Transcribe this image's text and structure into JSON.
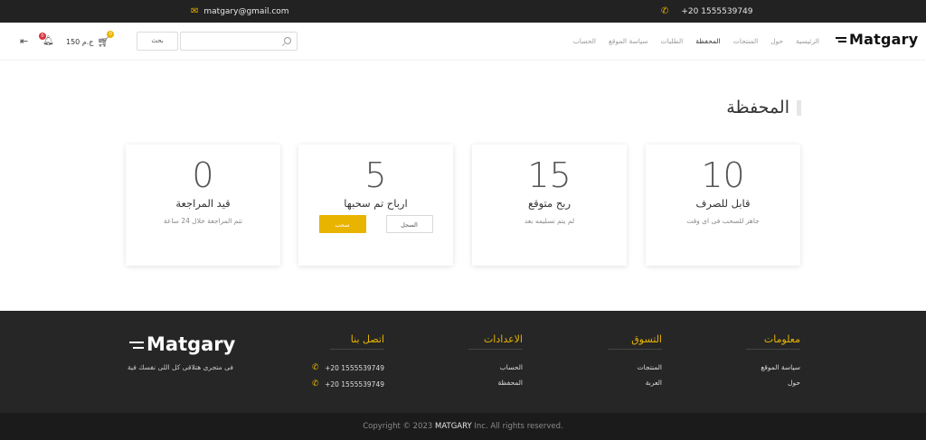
{
  "topbar": {
    "email": "matgary@gmail.com",
    "phone": "+20 1555539749",
    "email_icon": "envelope-icon",
    "phone_icon": "phone-icon"
  },
  "navbar": {
    "logo": "Matgary",
    "menu": [
      "الرئيسية",
      "حول",
      "المنتجات",
      "المحفظة",
      "الطلبات",
      "سياسة الموقع",
      "الحساب"
    ],
    "active_menu": "المحفظة",
    "search_button": "بحث",
    "search_placeholder": "",
    "cart_amount": "150 ج.م",
    "cart_count": "0",
    "notification_count": "0"
  },
  "page": {
    "title": "المحفظة"
  },
  "cards": [
    {
      "value": "10",
      "title": "قابل للصرف",
      "subtitle": "جاهز للسحب فى اى وقت"
    },
    {
      "value": "15",
      "title": "ربح متوقع",
      "subtitle": "لم يتم تسليمه بعد"
    },
    {
      "value": "5",
      "title": "ارباح تم سحبها",
      "log_button": "السجل",
      "withdraw_button": "سحب"
    },
    {
      "value": "0",
      "title": "قيد المراجعة",
      "subtitle": "تتم المراجعة خلال 24 ساعة"
    }
  ],
  "footer": {
    "info": {
      "heading": "معلومات",
      "links": [
        "سياسة الموقع",
        "حول"
      ]
    },
    "shopping": {
      "heading": "التسوق",
      "links": [
        "المنتجات",
        "العربة"
      ]
    },
    "settings": {
      "heading": "الاعدادات",
      "links": [
        "الحساب",
        "المحفظة"
      ]
    },
    "contact": {
      "heading": "اتصل بنا",
      "phones": [
        "+20 1555539749",
        "+20 1555539749"
      ]
    },
    "logo": "Matgary",
    "tagline": "فى متجرى هتلاقى كل اللى نفسك فية"
  },
  "copyright": {
    "prefix": "Copyright © 2023",
    "brand": "MATGARY",
    "suffix": "Inc. All rights reserved."
  },
  "colors": {
    "accent": "#e8b400",
    "dark": "#222222",
    "badge_red": "#d9333f"
  }
}
